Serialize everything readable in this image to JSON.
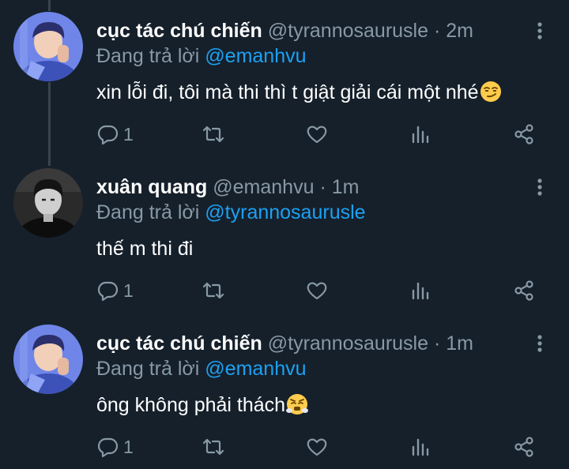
{
  "tweets": [
    {
      "name": "cục tác chú chiến",
      "handle": "@tyrannosaurusle",
      "time": "· 2m",
      "reply_prefix": "Đang trả lời",
      "reply_to": "@emanhvu",
      "text": "xin lỗi đi, tôi mà thi thì t giật giải cái một nhé",
      "emoji": "smirk-emoji",
      "reply_count": "1",
      "avatar": "blue-avatar"
    },
    {
      "name": "xuân quang",
      "handle": "@emanhvu",
      "time": "· 1m",
      "reply_prefix": "Đang trả lời",
      "reply_to": "@tyrannosaurusle",
      "text": "thế m thi đi",
      "emoji": "",
      "reply_count": "1",
      "avatar": "grayscale-avatar"
    },
    {
      "name": "cục tác chú chiến",
      "handle": "@tyrannosaurusle",
      "time": "· 1m",
      "reply_prefix": "Đang trả lời",
      "reply_to": "@emanhvu",
      "text": "ông không phải thách",
      "emoji": "triumph-emoji",
      "reply_count": "1",
      "avatar": "blue-avatar"
    }
  ],
  "actions": [
    "reply-icon",
    "retweet-icon",
    "like-icon",
    "analytics-icon",
    "share-icon"
  ],
  "colors": {
    "background": "#15202b",
    "muted": "#8899a6",
    "mention": "#1da1f2",
    "divider": "#38444d"
  }
}
